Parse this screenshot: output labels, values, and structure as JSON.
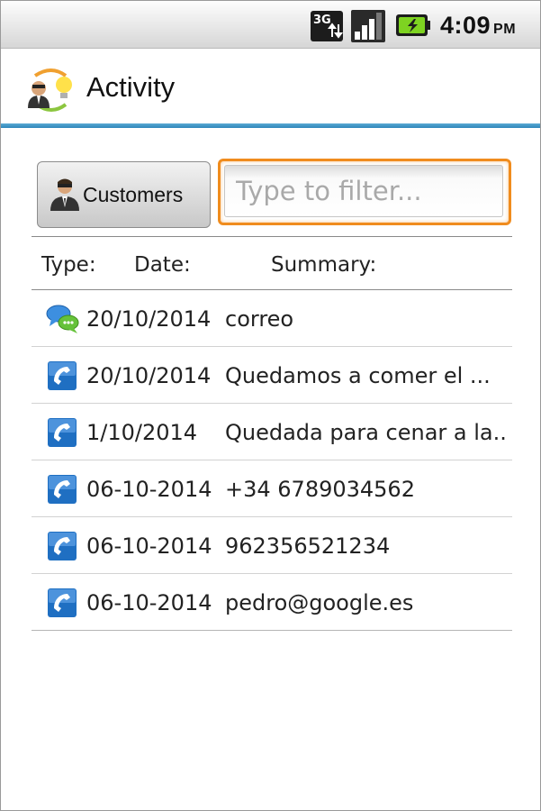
{
  "status_bar": {
    "network_label": "3G",
    "time": "4:09",
    "ampm": "PM",
    "icons": [
      "3g-data-icon",
      "signal-icon",
      "battery-charging-icon"
    ]
  },
  "app": {
    "title": "Activity",
    "icon": "activity-app-icon"
  },
  "toolbar": {
    "customers_label": "Customers",
    "filter_placeholder": "Type to filter...",
    "filter_value": ""
  },
  "columns": {
    "type": "Type:",
    "date": "Date:",
    "summary": "Summary:"
  },
  "rows": [
    {
      "type": "message",
      "icon": "chat-icon",
      "date": "20/10/2014",
      "summary": "correo"
    },
    {
      "type": "call",
      "icon": "phone-icon",
      "date": "20/10/2014",
      "summary": "Quedamos a comer el  ..."
    },
    {
      "type": "call",
      "icon": "phone-icon",
      "date": "1/10/2014",
      "summary": "Quedada para cenar a la..."
    },
    {
      "type": "call",
      "icon": "phone-icon",
      "date": "06-10-2014",
      "summary": "+34 6789034562"
    },
    {
      "type": "call",
      "icon": "phone-icon",
      "date": "06-10-2014",
      "summary": "962356521234"
    },
    {
      "type": "call",
      "icon": "phone-icon",
      "date": "06-10-2014",
      "summary": "pedro@google.es"
    }
  ],
  "colors": {
    "accent_orange": "#f08c1e",
    "titlebar_line": "#3a90c4",
    "phone_icon_blue": "#1f6fc2"
  }
}
